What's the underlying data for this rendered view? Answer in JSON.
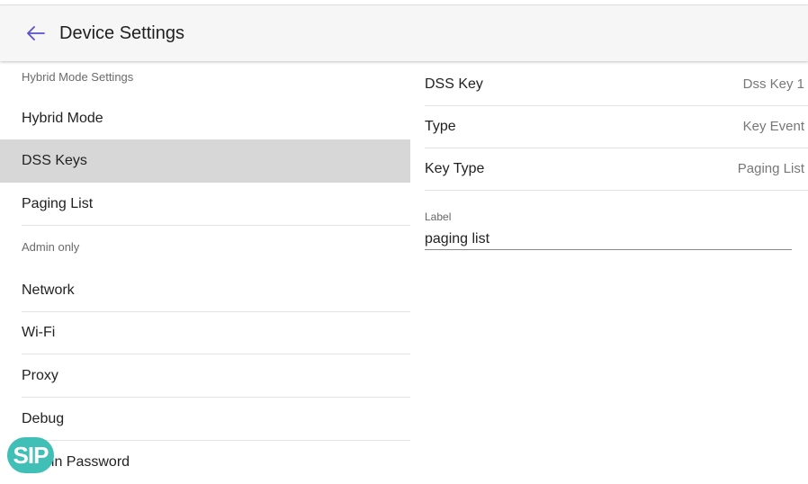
{
  "top_strip": {
    "text": "　　　　"
  },
  "header": {
    "title": "Device Settings"
  },
  "left": {
    "section1": "Hybrid Mode Settings",
    "hybrid_mode": "Hybrid Mode",
    "dss_keys": "DSS Keys",
    "paging_list": "Paging List",
    "section2": "Admin only",
    "network": "Network",
    "wifi": "Wi-Fi",
    "proxy": "Proxy",
    "debug": "Debug",
    "admin_password": "Admin Password"
  },
  "right": {
    "dss_key": {
      "label": "DSS Key",
      "value": "Dss Key 1"
    },
    "type": {
      "label": "Type",
      "value": "Key Event"
    },
    "key_type": {
      "label": "Key Type",
      "value": "Paging List"
    },
    "label_field": {
      "label": "Label",
      "value": "paging list"
    }
  },
  "badge": {
    "text": "SIP"
  },
  "colors": {
    "selected_bg": "#d7d7d7",
    "header_bg": "#f6f6f6",
    "accent": "#3fbfb5",
    "back_arrow": "#5a4fcf"
  }
}
